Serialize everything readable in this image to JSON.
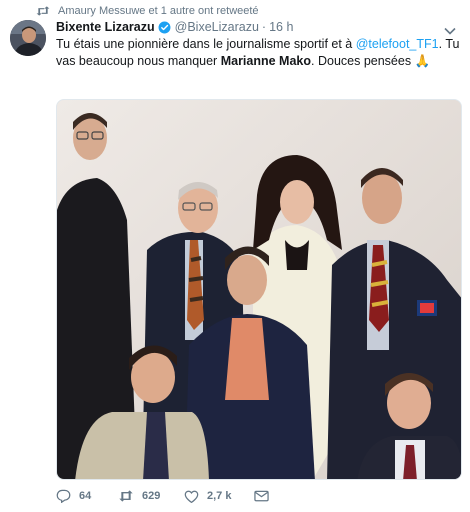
{
  "retweet": {
    "text": "Amaury Messuwe et 1 autre ont retweeté"
  },
  "tweet": {
    "author_name": "Bixente Lizarazu",
    "handle": "@BixeLizarazu",
    "dot": "·",
    "time": "16 h",
    "text_part1": "Tu étais une pionnière dans le journalisme sportif et à ",
    "mention": "@telefoot_TF1",
    "text_part2": ". Tu vas beaucoup nous manquer ",
    "bold_name": "Marianne Mako",
    "text_part3": ". Douces pensées  🙏"
  },
  "actions": {
    "replies": "64",
    "retweets": "629",
    "likes": "2,7 k"
  },
  "photo": {
    "description_alt": ""
  },
  "colors": {
    "link": "#1da1f2",
    "muted": "#657786",
    "text": "#14171a",
    "verified": "#1da1f2"
  }
}
